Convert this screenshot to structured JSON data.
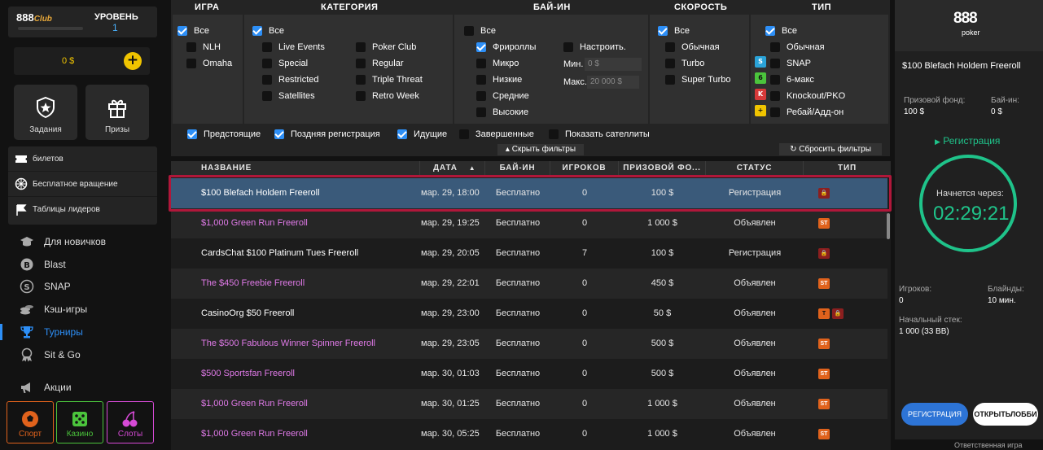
{
  "sidebar": {
    "club_logo": "888",
    "club_suffix": "Club",
    "level_label": "УРОВЕНЬ",
    "level_value": "1",
    "balance": "0 $",
    "tiles": [
      {
        "label": "Задания"
      },
      {
        "label": "Призы"
      }
    ],
    "menu": [
      {
        "label": "билетов"
      },
      {
        "label": "Бесплатное вращение"
      },
      {
        "label": "Таблицы лидеров"
      }
    ],
    "nav": [
      {
        "label": "Для новичков"
      },
      {
        "label": "Blast"
      },
      {
        "label": "SNAP"
      },
      {
        "label": "Кэш-игры"
      },
      {
        "label": "Турниры"
      },
      {
        "label": "Sit & Go"
      },
      {
        "label": "Акции"
      }
    ],
    "products": [
      {
        "label": "Спорт"
      },
      {
        "label": "Казино"
      },
      {
        "label": "Слоты"
      }
    ]
  },
  "filters": {
    "headers": {
      "game": "ИГРА",
      "category": "КАТЕГОРИЯ",
      "buyin": "БАЙ-ИН",
      "speed": "СКОРОСТЬ",
      "type": "ТИП"
    },
    "game": [
      "Все",
      "NLH",
      "Omaha"
    ],
    "category": [
      "Все",
      "Live Events",
      "Special",
      "Restricted",
      "Satellites",
      "Poker Club",
      "Regular",
      "Triple Threat",
      "Retro Week"
    ],
    "buyin": [
      "Все",
      "Фрироллы",
      "Микро",
      "Низкие",
      "Средние",
      "Высокие",
      "Настроить.",
      "Мин.",
      "Макс."
    ],
    "buyin_min_placeholder": "0 $",
    "buyin_max_placeholder": "20 000 $",
    "speed": [
      "Все",
      "Обычная",
      "Turbo",
      "Super Turbo"
    ],
    "type": [
      "Все",
      "Обычная",
      "SNAP",
      "6-макс",
      "Knockout/PKO",
      "Ребай/Адд-он"
    ],
    "bottom": [
      "Предстоящие",
      "Поздняя регистрация",
      "Идущие",
      "Завершенные",
      "Показать сателлиты"
    ],
    "hide_label": "Скрыть фильтры",
    "reset_label": "Сбросить фильтры"
  },
  "table": {
    "columns": [
      "НАЗВАНИЕ",
      "ДАТА",
      "БАЙ-ИН",
      "ИГРОКОВ",
      "ПРИЗОВОЙ ФО...",
      "СТАТУС",
      "ТИП"
    ],
    "rows": [
      {
        "name": "$100 Blefach Holdem Freeroll",
        "date": "мар. 29, 18:00",
        "buyin": "Бесплатно",
        "players": "0",
        "prize": "100 $",
        "status": "Регистрация",
        "tags": [
          "lock"
        ],
        "color": "#ffffff"
      },
      {
        "name": "$1,000 Green Run Freeroll",
        "date": "мар. 29, 19:25",
        "buyin": "Бесплатно",
        "players": "0",
        "prize": "1 000 $",
        "status": "Объявлен",
        "tags": [
          "st"
        ],
        "color": "#e07ae8"
      },
      {
        "name": "CardsChat $100 Platinum Tues Freeroll",
        "date": "мар. 29, 20:05",
        "buyin": "Бесплатно",
        "players": "7",
        "prize": "100 $",
        "status": "Регистрация",
        "tags": [
          "lock"
        ],
        "color": "#ffffff"
      },
      {
        "name": "The $450 Freebie Freeroll",
        "date": "мар. 29, 22:01",
        "buyin": "Бесплатно",
        "players": "0",
        "prize": "450 $",
        "status": "Объявлен",
        "tags": [
          "st"
        ],
        "color": "#e07ae8"
      },
      {
        "name": "CasinoOrg $50 Freeroll",
        "date": "мар. 29, 23:00",
        "buyin": "Бесплатно",
        "players": "0",
        "prize": "50 $",
        "status": "Объявлен",
        "tags": [
          "t",
          "lock"
        ],
        "color": "#ffffff"
      },
      {
        "name": "The $500 Fabulous Winner Spinner Freeroll",
        "date": "мар. 29, 23:05",
        "buyin": "Бесплатно",
        "players": "0",
        "prize": "500 $",
        "status": "Объявлен",
        "tags": [
          "st"
        ],
        "color": "#e07ae8"
      },
      {
        "name": "$500 Sportsfan Freeroll",
        "date": "мар. 30, 01:03",
        "buyin": "Бесплатно",
        "players": "0",
        "prize": "500 $",
        "status": "Объявлен",
        "tags": [
          "st"
        ],
        "color": "#e07ae8"
      },
      {
        "name": "$1,000 Green Run Freeroll",
        "date": "мар. 30, 01:25",
        "buyin": "Бесплатно",
        "players": "0",
        "prize": "1 000 $",
        "status": "Объявлен",
        "tags": [
          "st"
        ],
        "color": "#e07ae8"
      },
      {
        "name": "$1,000 Green Run Freeroll",
        "date": "мар. 30, 05:25",
        "buyin": "Бесплатно",
        "players": "0",
        "prize": "1 000 $",
        "status": "Объявлен",
        "tags": [
          "st"
        ],
        "color": "#e07ae8"
      }
    ]
  },
  "panel": {
    "logo": "888",
    "logo_sub": "poker",
    "title": "$100 Blefach Holdem Freeroll",
    "prize_label": "Призовой фонд:",
    "prize_value": "100 $",
    "buyin_label": "Бай-ин:",
    "buyin_value": "0 $",
    "reg_status": "Регистрация",
    "starts_label": "Начнется через:",
    "timer": "02:29:21",
    "players_label": "Игроков:",
    "players_value": "0",
    "blinds_label": "Блайнды:",
    "blinds_value": "10 мин.",
    "stack_label": "Начальный стек:",
    "stack_value": "1 000 (33 BB)",
    "register_btn": "РЕГИСТРАЦИЯ",
    "lobby_btn": "ОТКРЫТЬЛОББИ",
    "responsible": "Ответственная игра"
  },
  "colors": {
    "accent": "#2d8ff7",
    "timer": "#1fc38a",
    "selected_outline": "#b0173a",
    "promo_name": "#e07ae8"
  }
}
